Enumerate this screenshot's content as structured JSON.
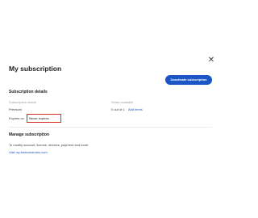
{
  "dialog": {
    "title": "My subscription",
    "close_icon": "close-icon"
  },
  "actions": {
    "deactivate_label": "Deactivate subscription"
  },
  "details": {
    "heading": "Subscription details",
    "status_label": "Subscription status",
    "status_value": "Premium",
    "seats_label": "Seats available",
    "seats_value": "0 out of 1",
    "add_items_link": "Add items",
    "expires_label": "Expires on",
    "expires_value": "Never expires"
  },
  "manage": {
    "heading": "Manage subscription",
    "description": "To modify account, license, devices, payment and more:",
    "link": "Visit my.beeeandroles.com"
  },
  "colors": {
    "primary_button": "#1a56c4",
    "highlight_border": "#d93025"
  }
}
